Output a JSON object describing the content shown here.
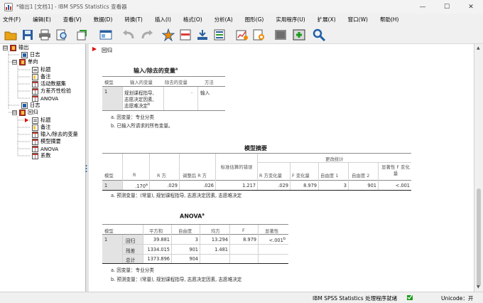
{
  "window": {
    "title": "*输出1 [文档1] - IBM SPSS Statistics 查看器",
    "controls": {
      "minimize": "—",
      "maximize": "☐",
      "close": "✕"
    }
  },
  "menu": [
    "文件(F)",
    "编辑(E)",
    "查看(V)",
    "数据(D)",
    "转换(T)",
    "插入(I)",
    "格式(O)",
    "分析(A)",
    "图形(G)",
    "实用程序(U)",
    "扩展(X)",
    "窗口(W)",
    "帮助(H)"
  ],
  "toolbar_icons": [
    "open-folder-icon",
    "save-icon",
    "print-icon",
    "print-preview-icon",
    "export-icon",
    "recall-dialog-icon",
    "undo-icon",
    "redo-icon",
    "goto-data-icon",
    "goto-case-icon",
    "variables-icon",
    "select-last-output-icon",
    "designate-window-icon",
    "pivot-icon",
    "promote-icon",
    "insert-heading-icon",
    "find-icon"
  ],
  "outline": {
    "items": [
      {
        "label": "输出",
        "icon": "book-icon",
        "expand": "⊟"
      },
      {
        "label": "日志",
        "icon": "log-icon"
      },
      {
        "label": "单向",
        "icon": "book-icon",
        "expand": "⊟"
      },
      {
        "label": "标题",
        "icon": "page-icon"
      },
      {
        "label": "备注",
        "icon": "note-icon"
      },
      {
        "label": "活动数据集",
        "icon": "table-icon"
      },
      {
        "label": "方差齐性检验",
        "icon": "table-icon"
      },
      {
        "label": "ANOVA",
        "icon": "table-icon"
      },
      {
        "label": "日志",
        "icon": "log-icon"
      },
      {
        "label": "回归",
        "icon": "book-icon",
        "expand": "⊟"
      },
      {
        "label": "标题",
        "icon": "page-icon"
      },
      {
        "label": "备注",
        "icon": "note-icon"
      },
      {
        "label": "输入/除去的变量",
        "icon": "table-icon"
      },
      {
        "label": "模型摘要",
        "icon": "table-icon"
      },
      {
        "label": "ANOVA",
        "icon": "table-icon"
      },
      {
        "label": "系数",
        "icon": "table-icon"
      }
    ]
  },
  "output": {
    "heading": "回归",
    "entered_table": {
      "title": "输入/除去的变量",
      "title_sup": "a",
      "headers": [
        "模型",
        "输入的变量",
        "除去的变量",
        "方法"
      ],
      "row": {
        "model": "1",
        "entered": [
          "规划课程指导,",
          "志愿决定因素,",
          "志愿难决定"
        ],
        "entered_sup": "b",
        "removed": ".",
        "method": "输入"
      },
      "notes": [
        "a. 因变量：专业分类",
        "b. 已输入所请求的所有变量。"
      ]
    },
    "model_summary": {
      "title": "模型摘要",
      "change_group": "更改统计",
      "headers": [
        "模型",
        "R",
        "R 方",
        "调整后 R 方",
        "标准估算的错误",
        "R 方变化量",
        "F 变化量",
        "自由度 1",
        "自由度 2",
        "显著性 F 变化量"
      ],
      "row": {
        "model": "1",
        "r": ".170",
        "r_sup": "a",
        "r2": ".029",
        "adj_r2": ".026",
        "se": "1.217",
        "r2_change": ".029",
        "f_change": "8.979",
        "df1": "3",
        "df2": "901",
        "sig_f_change": "<.001"
      },
      "notes": [
        "a. 预测变量：(常量), 规划课程指导, 志愿决定因素, 志愿难决定"
      ]
    },
    "anova": {
      "title": "ANOVA",
      "title_sup": "a",
      "headers": [
        "模型",
        "平方和",
        "自由度",
        "均方",
        "F",
        "显著性"
      ],
      "model": "1",
      "rows": [
        {
          "label": "回归",
          "ss": "39.881",
          "df": "3",
          "ms": "13.294",
          "f": "8.979",
          "sig": "<.001",
          "sig_sup": "b"
        },
        {
          "label": "残差",
          "ss": "1334.015",
          "df": "901",
          "ms": "1.481",
          "f": "",
          "sig": ""
        },
        {
          "label": "总计",
          "ss": "1373.896",
          "df": "904",
          "ms": "",
          "f": "",
          "sig": ""
        }
      ],
      "notes": [
        "a. 因变量：专业分类",
        "b. 预测变量：(常量), 规划课程指导, 志愿决定因素, 志愿难决定"
      ]
    }
  },
  "status": {
    "processor": "IBM SPSS Statistics 处理程序就绪",
    "unicode": "Unicode：开"
  }
}
